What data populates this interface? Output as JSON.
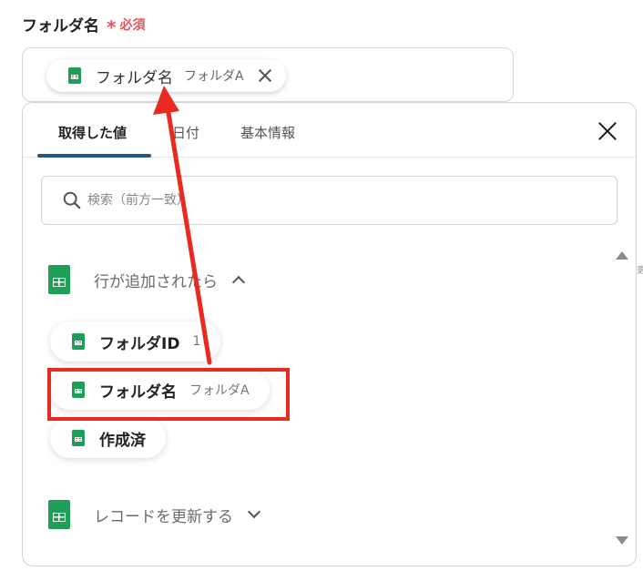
{
  "field": {
    "label": "フォルダ名",
    "required_mark": "*",
    "required_text": "必須",
    "chip": {
      "label": "フォルダ名",
      "sub": "フォルダA",
      "icon": "google-sheets-icon"
    }
  },
  "panel": {
    "tabs": [
      {
        "label": "取得した値",
        "active": true
      },
      {
        "label": "日付",
        "active": false
      },
      {
        "label": "基本情報",
        "active": false
      }
    ],
    "search_placeholder": "検索（前方一致）",
    "sections": [
      {
        "title": "行が追加されたら",
        "expanded": true,
        "icon": "google-sheets-icon",
        "items": [
          {
            "label": "フォルダID",
            "sub": "1"
          },
          {
            "label": "フォルダ名",
            "sub": "フォルダA",
            "highlighted": true
          },
          {
            "label": "作成済",
            "sub": ""
          }
        ]
      },
      {
        "title": "レコードを更新する",
        "expanded": false,
        "icon": "google-sheets-icon"
      }
    ]
  },
  "edge_text": "更",
  "colors": {
    "required": "#e2565c",
    "sheets_green": "#1e9e57",
    "tab_underline": "#1d5a7b",
    "annotation_red": "#ea2a1f"
  }
}
